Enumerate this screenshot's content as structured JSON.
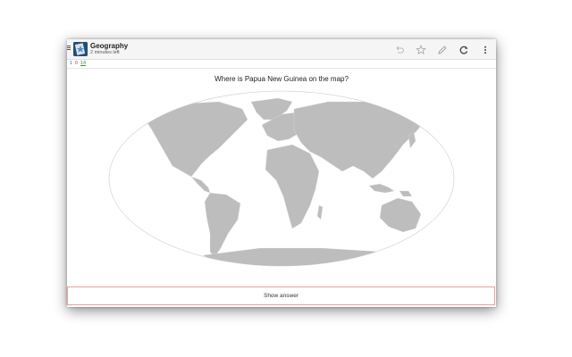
{
  "app": {
    "title": "Geography",
    "subtitle": "2 minutes left",
    "status": {
      "new_count": "1",
      "learn_count": "0",
      "review_count": "14"
    }
  },
  "toolbar": {
    "icons": [
      "undo-icon",
      "star-icon",
      "edit-icon",
      "refresh-icon",
      "more-vert-icon"
    ]
  },
  "card": {
    "question": "Where is Papua New Guinea on the map?",
    "show_answer_label": "Show answer"
  },
  "colors": {
    "land": "#bdbdbd",
    "outline": "#d7d7d7",
    "status_new": "#1976d2",
    "status_learn": "#d32f2f",
    "status_review": "#388e3c",
    "answer_border": "#e8a0a0"
  }
}
